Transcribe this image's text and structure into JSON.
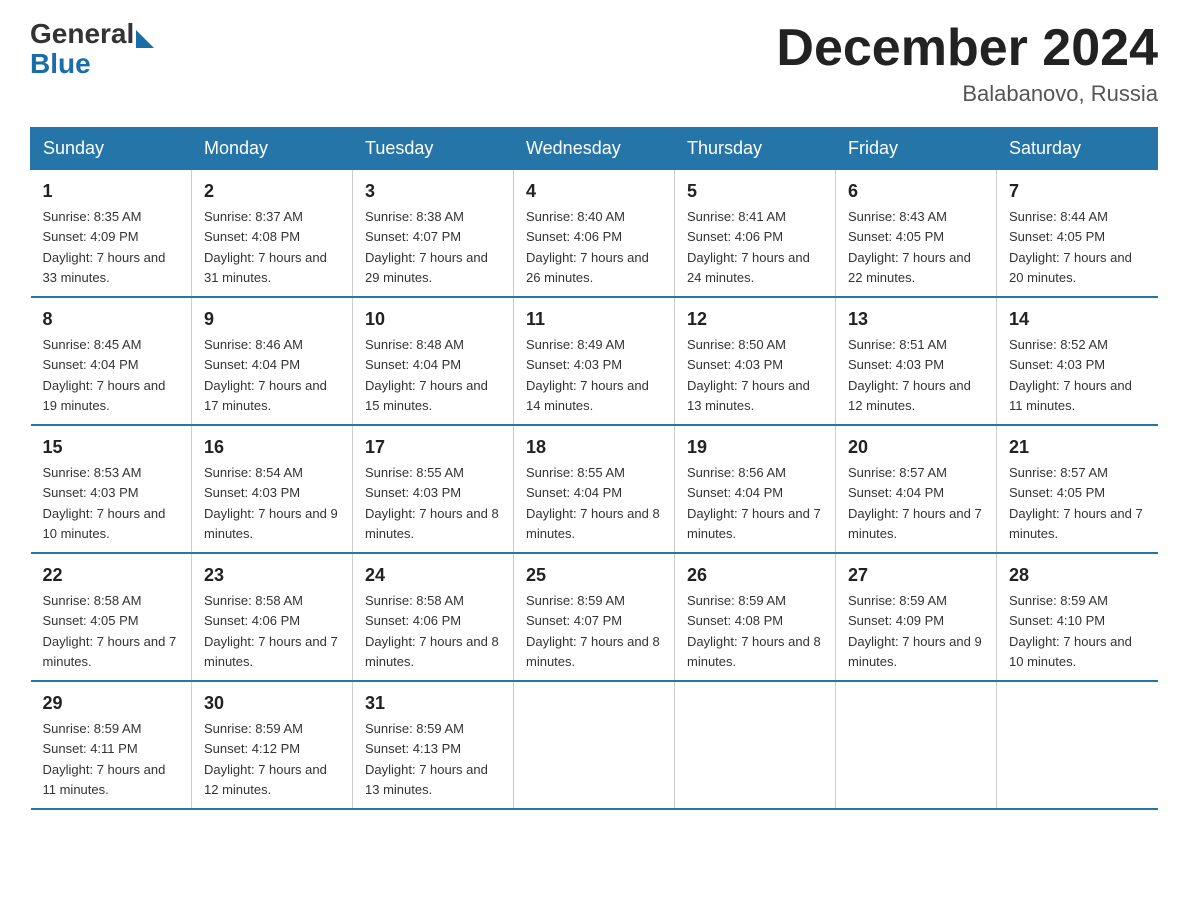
{
  "logo": {
    "general": "General",
    "blue": "Blue"
  },
  "title": "December 2024",
  "location": "Balabanovo, Russia",
  "days_header": [
    "Sunday",
    "Monday",
    "Tuesday",
    "Wednesday",
    "Thursday",
    "Friday",
    "Saturday"
  ],
  "weeks": [
    [
      {
        "day": "1",
        "sunrise": "8:35 AM",
        "sunset": "4:09 PM",
        "daylight": "7 hours and 33 minutes."
      },
      {
        "day": "2",
        "sunrise": "8:37 AM",
        "sunset": "4:08 PM",
        "daylight": "7 hours and 31 minutes."
      },
      {
        "day": "3",
        "sunrise": "8:38 AM",
        "sunset": "4:07 PM",
        "daylight": "7 hours and 29 minutes."
      },
      {
        "day": "4",
        "sunrise": "8:40 AM",
        "sunset": "4:06 PM",
        "daylight": "7 hours and 26 minutes."
      },
      {
        "day": "5",
        "sunrise": "8:41 AM",
        "sunset": "4:06 PM",
        "daylight": "7 hours and 24 minutes."
      },
      {
        "day": "6",
        "sunrise": "8:43 AM",
        "sunset": "4:05 PM",
        "daylight": "7 hours and 22 minutes."
      },
      {
        "day": "7",
        "sunrise": "8:44 AM",
        "sunset": "4:05 PM",
        "daylight": "7 hours and 20 minutes."
      }
    ],
    [
      {
        "day": "8",
        "sunrise": "8:45 AM",
        "sunset": "4:04 PM",
        "daylight": "7 hours and 19 minutes."
      },
      {
        "day": "9",
        "sunrise": "8:46 AM",
        "sunset": "4:04 PM",
        "daylight": "7 hours and 17 minutes."
      },
      {
        "day": "10",
        "sunrise": "8:48 AM",
        "sunset": "4:04 PM",
        "daylight": "7 hours and 15 minutes."
      },
      {
        "day": "11",
        "sunrise": "8:49 AM",
        "sunset": "4:03 PM",
        "daylight": "7 hours and 14 minutes."
      },
      {
        "day": "12",
        "sunrise": "8:50 AM",
        "sunset": "4:03 PM",
        "daylight": "7 hours and 13 minutes."
      },
      {
        "day": "13",
        "sunrise": "8:51 AM",
        "sunset": "4:03 PM",
        "daylight": "7 hours and 12 minutes."
      },
      {
        "day": "14",
        "sunrise": "8:52 AM",
        "sunset": "4:03 PM",
        "daylight": "7 hours and 11 minutes."
      }
    ],
    [
      {
        "day": "15",
        "sunrise": "8:53 AM",
        "sunset": "4:03 PM",
        "daylight": "7 hours and 10 minutes."
      },
      {
        "day": "16",
        "sunrise": "8:54 AM",
        "sunset": "4:03 PM",
        "daylight": "7 hours and 9 minutes."
      },
      {
        "day": "17",
        "sunrise": "8:55 AM",
        "sunset": "4:03 PM",
        "daylight": "7 hours and 8 minutes."
      },
      {
        "day": "18",
        "sunrise": "8:55 AM",
        "sunset": "4:04 PM",
        "daylight": "7 hours and 8 minutes."
      },
      {
        "day": "19",
        "sunrise": "8:56 AM",
        "sunset": "4:04 PM",
        "daylight": "7 hours and 7 minutes."
      },
      {
        "day": "20",
        "sunrise": "8:57 AM",
        "sunset": "4:04 PM",
        "daylight": "7 hours and 7 minutes."
      },
      {
        "day": "21",
        "sunrise": "8:57 AM",
        "sunset": "4:05 PM",
        "daylight": "7 hours and 7 minutes."
      }
    ],
    [
      {
        "day": "22",
        "sunrise": "8:58 AM",
        "sunset": "4:05 PM",
        "daylight": "7 hours and 7 minutes."
      },
      {
        "day": "23",
        "sunrise": "8:58 AM",
        "sunset": "4:06 PM",
        "daylight": "7 hours and 7 minutes."
      },
      {
        "day": "24",
        "sunrise": "8:58 AM",
        "sunset": "4:06 PM",
        "daylight": "7 hours and 8 minutes."
      },
      {
        "day": "25",
        "sunrise": "8:59 AM",
        "sunset": "4:07 PM",
        "daylight": "7 hours and 8 minutes."
      },
      {
        "day": "26",
        "sunrise": "8:59 AM",
        "sunset": "4:08 PM",
        "daylight": "7 hours and 8 minutes."
      },
      {
        "day": "27",
        "sunrise": "8:59 AM",
        "sunset": "4:09 PM",
        "daylight": "7 hours and 9 minutes."
      },
      {
        "day": "28",
        "sunrise": "8:59 AM",
        "sunset": "4:10 PM",
        "daylight": "7 hours and 10 minutes."
      }
    ],
    [
      {
        "day": "29",
        "sunrise": "8:59 AM",
        "sunset": "4:11 PM",
        "daylight": "7 hours and 11 minutes."
      },
      {
        "day": "30",
        "sunrise": "8:59 AM",
        "sunset": "4:12 PM",
        "daylight": "7 hours and 12 minutes."
      },
      {
        "day": "31",
        "sunrise": "8:59 AM",
        "sunset": "4:13 PM",
        "daylight": "7 hours and 13 minutes."
      },
      null,
      null,
      null,
      null
    ]
  ]
}
